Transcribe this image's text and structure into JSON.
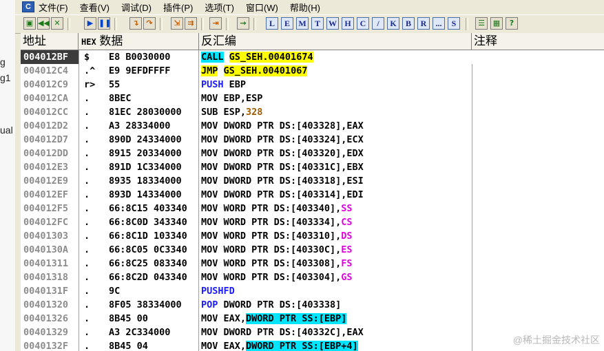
{
  "sidebar_fragments": [
    "g",
    "g1",
    "ual"
  ],
  "menu": [
    "文件(F)",
    "查看(V)",
    "调试(D)",
    "插件(P)",
    "选项(T)",
    "窗口(W)",
    "帮助(H)"
  ],
  "toolbar_letters": [
    "L",
    "E",
    "M",
    "T",
    "W",
    "H",
    "C",
    "/",
    "K",
    "B",
    "R",
    "...",
    "S"
  ],
  "columns": {
    "address": "地址",
    "hex_tag": "HEX",
    "data": "数据",
    "disassembly": "反汇编",
    "comment": "注释"
  },
  "rows": [
    {
      "addr": "004012BF",
      "mark": "$",
      "hex": "E8 B0030000",
      "mn": "CALL",
      "ops": "GS_SEH.00401674",
      "selected": true
    },
    {
      "addr": "004012C4",
      "mark": ".^",
      "hex": "E9 9EFDFFFF",
      "mn": "JMP",
      "ops": "GS_SEH.00401067"
    },
    {
      "addr": "004012C9",
      "mark": "r>",
      "hex": "55",
      "mn": "PUSH",
      "ops": "EBP"
    },
    {
      "addr": "004012CA",
      "mark": ".",
      "hex": "8BEC",
      "mn": "MOV",
      "ops": "EBP,ESP"
    },
    {
      "addr": "004012CC",
      "mark": ".",
      "hex": "81EC 28030000",
      "mn": "SUB",
      "ops": "ESP,328"
    },
    {
      "addr": "004012D2",
      "mark": ".",
      "hex": "A3 28334000",
      "mn": "MOV",
      "ops": "DWORD PTR DS:[403328],EAX"
    },
    {
      "addr": "004012D7",
      "mark": ".",
      "hex": "890D 24334000",
      "mn": "MOV",
      "ops": "DWORD PTR DS:[403324],ECX"
    },
    {
      "addr": "004012DD",
      "mark": ".",
      "hex": "8915 20334000",
      "mn": "MOV",
      "ops": "DWORD PTR DS:[403320],EDX"
    },
    {
      "addr": "004012E3",
      "mark": ".",
      "hex": "891D 1C334000",
      "mn": "MOV",
      "ops": "DWORD PTR DS:[40331C],EBX"
    },
    {
      "addr": "004012E9",
      "mark": ".",
      "hex": "8935 18334000",
      "mn": "MOV",
      "ops": "DWORD PTR DS:[403318],ESI"
    },
    {
      "addr": "004012EF",
      "mark": ".",
      "hex": "893D 14334000",
      "mn": "MOV",
      "ops": "DWORD PTR DS:[403314],EDI"
    },
    {
      "addr": "004012F5",
      "mark": ".",
      "hex": "66:8C15 403340",
      "mn": "MOV",
      "ops": "WORD PTR DS:[403340],SS"
    },
    {
      "addr": "004012FC",
      "mark": ".",
      "hex": "66:8C0D 343340",
      "mn": "MOV",
      "ops": "WORD PTR DS:[403334],CS"
    },
    {
      "addr": "00401303",
      "mark": ".",
      "hex": "66:8C1D 103340",
      "mn": "MOV",
      "ops": "WORD PTR DS:[403310],DS"
    },
    {
      "addr": "0040130A",
      "mark": ".",
      "hex": "66:8C05 0C3340",
      "mn": "MOV",
      "ops": "WORD PTR DS:[40330C],ES"
    },
    {
      "addr": "00401311",
      "mark": ".",
      "hex": "66:8C25 083340",
      "mn": "MOV",
      "ops": "WORD PTR DS:[403308],FS"
    },
    {
      "addr": "00401318",
      "mark": ".",
      "hex": "66:8C2D 043340",
      "mn": "MOV",
      "ops": "WORD PTR DS:[403304],GS"
    },
    {
      "addr": "0040131F",
      "mark": ".",
      "hex": "9C",
      "mn": "PUSHFD",
      "ops": ""
    },
    {
      "addr": "00401320",
      "mark": ".",
      "hex": "8F05 38334000",
      "mn": "POP",
      "ops": "DWORD PTR DS:[403338]"
    },
    {
      "addr": "00401326",
      "mark": ".",
      "hex": "8B45 00",
      "mn": "MOV",
      "ops": "EAX,DWORD PTR SS:[EBP]"
    },
    {
      "addr": "00401329",
      "mark": ".",
      "hex": "A3 2C334000",
      "mn": "MOV",
      "ops": "DWORD PTR DS:[40332C],EAX"
    },
    {
      "addr": "0040132F",
      "mark": ".",
      "hex": "8B45 04",
      "mn": "MOV",
      "ops": "EAX,DWORD PTR SS:[EBP+4]"
    }
  ],
  "watermark": "@稀土掘金技术社区"
}
